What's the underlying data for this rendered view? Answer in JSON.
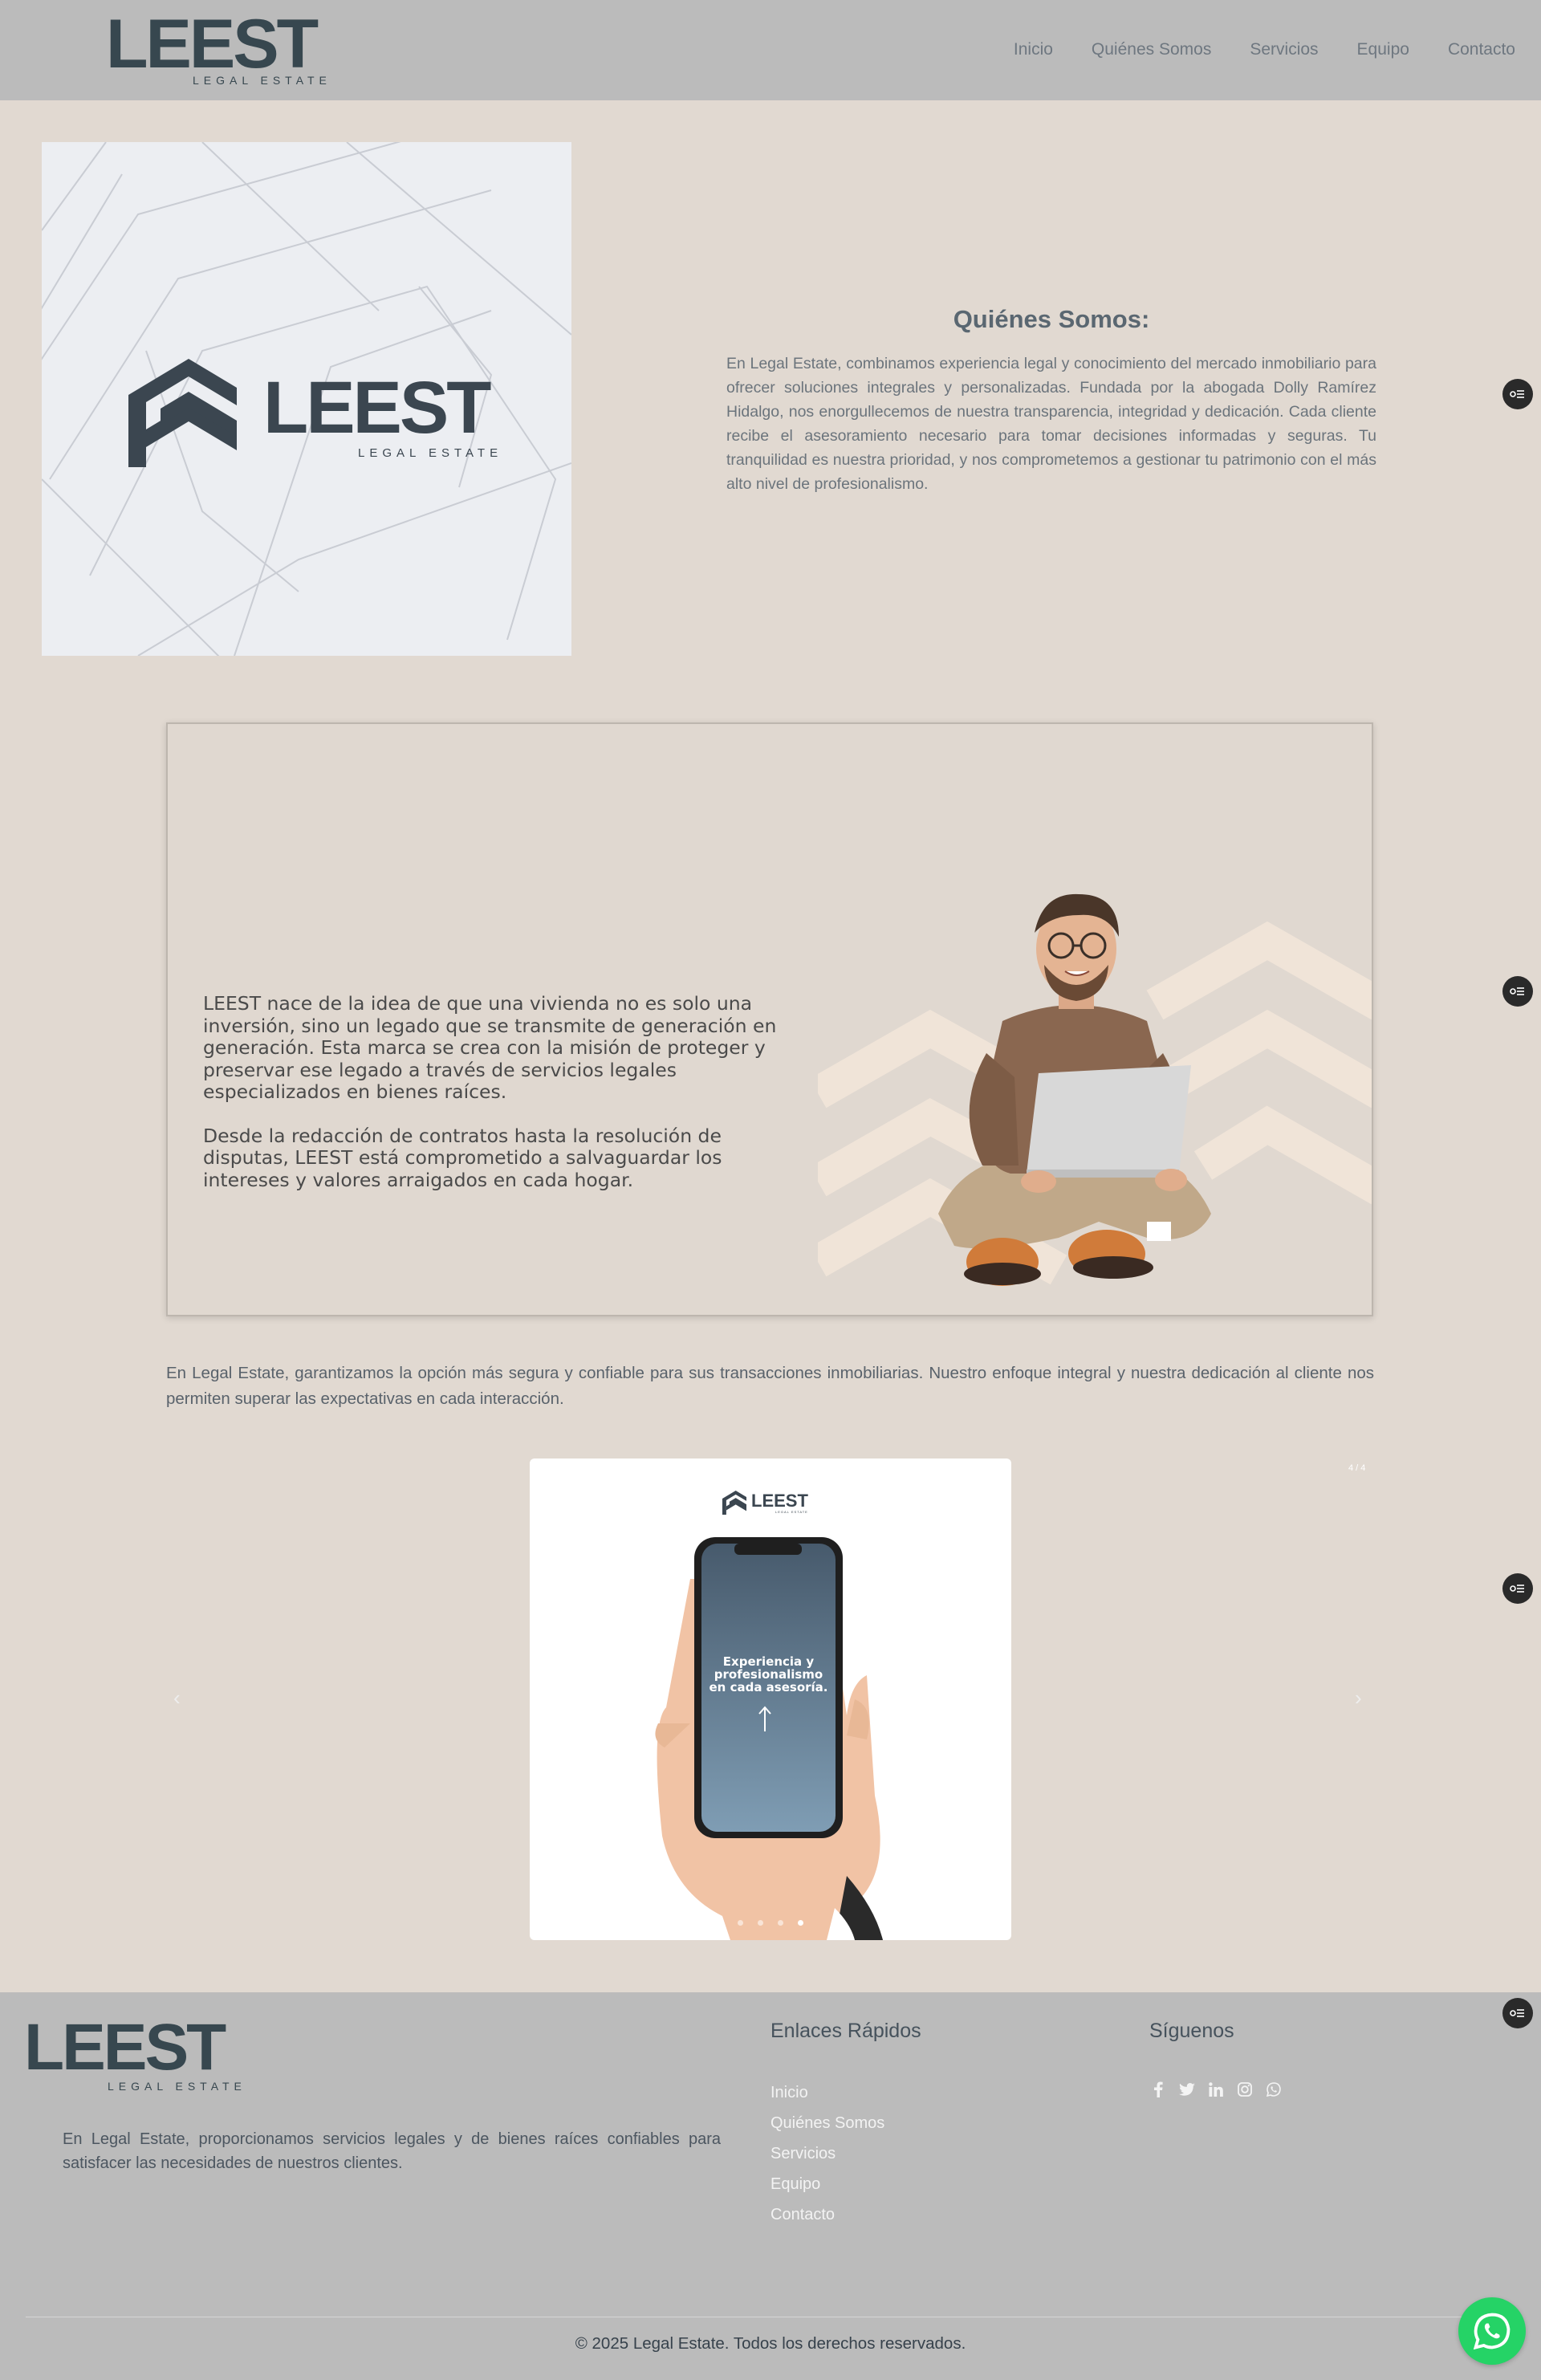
{
  "colors": {
    "header_bg": "#bbbbbb",
    "page_bg": "#e1d9d1",
    "brand": "#37474f",
    "whatsapp": "#25d366"
  },
  "header": {
    "logo_word": "LEEST",
    "logo_sub": "LEGAL ESTATE",
    "nav": [
      "Inicio",
      "Quiénes Somos",
      "Servicios",
      "Equipo",
      "Contacto"
    ]
  },
  "about": {
    "image_logo_word": "LEEST",
    "image_logo_sub": "LEGAL ESTATE",
    "title": "Quiénes Somos:",
    "text": "En Legal Estate, combinamos experiencia legal y conocimiento del mercado inmobiliario para ofrecer soluciones integrales y personalizadas. Fundada por la abogada Dolly Ramírez Hidalgo, nos enorgullecemos de nuestra transparencia, integridad y dedicación. Cada cliente recibe el asesoramiento necesario para tomar decisiones informadas y seguras. Tu tranquilidad es nuestra prioridad, y nos comprometemos a gestionar tu patrimonio con el más alto nivel de profesionalismo."
  },
  "card": {
    "paragraph1": "LEEST nace de la idea de que una vivienda no es solo una inversión, sino un legado que se transmite de generación en generación. Esta marca se crea con la misión de proteger y preservar ese legado a través de servicios legales especializados en bienes raíces.",
    "paragraph2": "Desde la redacción de contratos hasta la resolución de disputas, LEEST está comprometido a salvaguardar los intereses y valores arraigados en cada hogar."
  },
  "intro": {
    "text": "En Legal Estate, garantizamos la opción más segura y confiable para sus transacciones inmobiliarias. Nuestro enfoque integral y nuestra dedicación al cliente nos permiten superar las expectativas en cada interacción."
  },
  "carousel": {
    "counter": "4 / 4",
    "prev_icon": "chevron-left-icon",
    "next_icon": "chevron-right-icon",
    "slide_logo_word": "LEEST",
    "slide_logo_sub": "LEGAL ESTATE",
    "phone_text": [
      "Experiencia y",
      "profesionalismo",
      "en cada asesoría."
    ],
    "total_slides": 4,
    "active_slide": 4
  },
  "footer": {
    "logo_word": "LEEST",
    "logo_sub": "LEGAL ESTATE",
    "description": "En Legal Estate, proporcionamos servicios legales y de bienes raíces confiables para satisfacer las necesidades de nuestros clientes.",
    "links_title": "Enlaces Rápidos",
    "links": [
      "Inicio",
      "Quiénes Somos",
      "Servicios",
      "Equipo",
      "Contacto"
    ],
    "follow_title": "Síguenos",
    "socials": [
      "facebook-icon",
      "twitter-icon",
      "linkedin-icon",
      "instagram-icon",
      "whatsapp-icon"
    ],
    "copyright": "© 2025 Legal Estate. Todos los derechos reservados."
  }
}
